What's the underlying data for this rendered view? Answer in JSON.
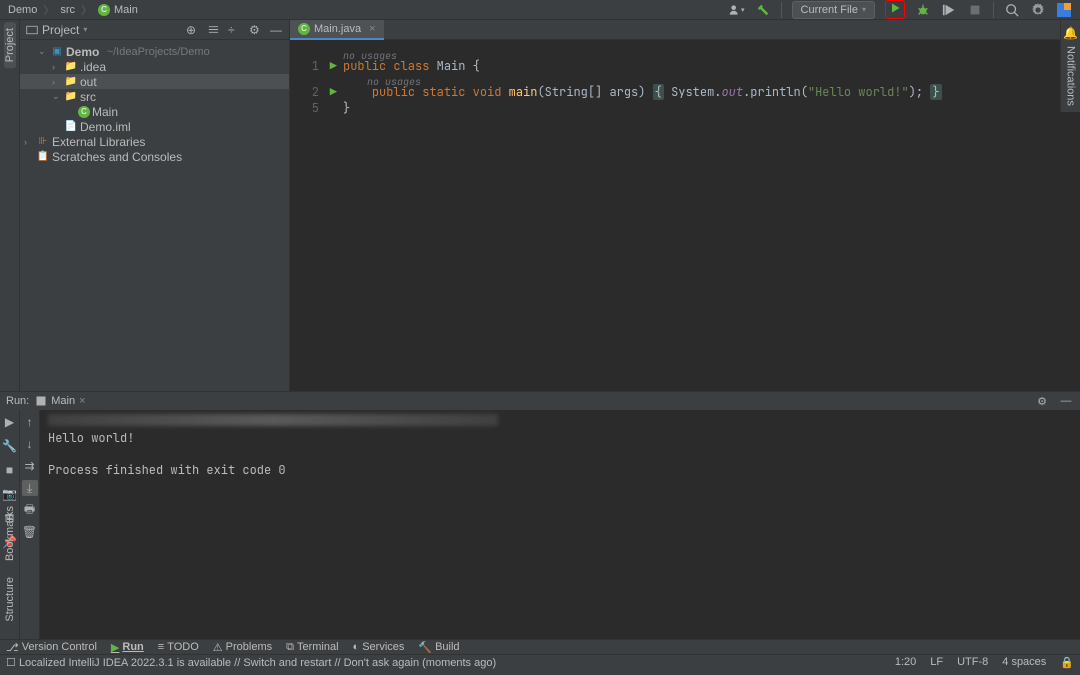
{
  "breadcrumb": {
    "project": "Demo",
    "folder": "src",
    "file": "Main"
  },
  "topbar": {
    "runConfig": "Current File"
  },
  "projectPanel": {
    "title": "Project",
    "root": {
      "name": "Demo",
      "path": "~/IdeaProjects/Demo"
    },
    "items": [
      {
        "name": ".idea",
        "type": "folder",
        "indent": 2
      },
      {
        "name": "out",
        "type": "folder-orange",
        "indent": 2,
        "selected": true
      },
      {
        "name": "src",
        "type": "folder-blue",
        "indent": 2,
        "expanded": true
      },
      {
        "name": "Main",
        "type": "class",
        "indent": 3
      },
      {
        "name": "Demo.iml",
        "type": "file",
        "indent": 2
      }
    ],
    "externalLibs": "External Libraries",
    "scratches": "Scratches and Consoles"
  },
  "editor": {
    "tabName": "Main.java",
    "usageHint1": "no usages",
    "usageHint2": "no usages",
    "lines": {
      "l1": {
        "n": "1"
      },
      "l2": {
        "n": "2"
      },
      "l5": {
        "n": "5"
      }
    },
    "code": {
      "kw_public": "public",
      "kw_class": "class",
      "cls_main": "Main",
      "brace_open": "{",
      "kw_static": "static",
      "kw_void": "void",
      "fn_main": "main",
      "sig": "(String[] args)",
      "sys": "System.",
      "out": "out",
      "println": ".println(",
      "str": "\"Hello world!\"",
      "close": ");",
      "brace_close": "}"
    }
  },
  "runPanel": {
    "label": "Run:",
    "tabName": "Main",
    "output1": "Hello world!",
    "output2": "Process finished with exit code 0"
  },
  "bottomTabs": {
    "vcs": "Version Control",
    "run": "Run",
    "todo": "TODO",
    "problems": "Problems",
    "terminal": "Terminal",
    "services": "Services",
    "build": "Build"
  },
  "statusBar": {
    "msg": "Localized IntelliJ IDEA 2022.3.1 is available // Switch and restart // Don't ask again (moments ago)",
    "pos": "1:20",
    "lineend": "LF",
    "encoding": "UTF-8",
    "indent": "4 spaces"
  },
  "leftStripe": {
    "project": "Project",
    "bookmarks": "Bookmarks",
    "structure": "Structure"
  },
  "rightStripe": {
    "notifications": "Notifications"
  }
}
